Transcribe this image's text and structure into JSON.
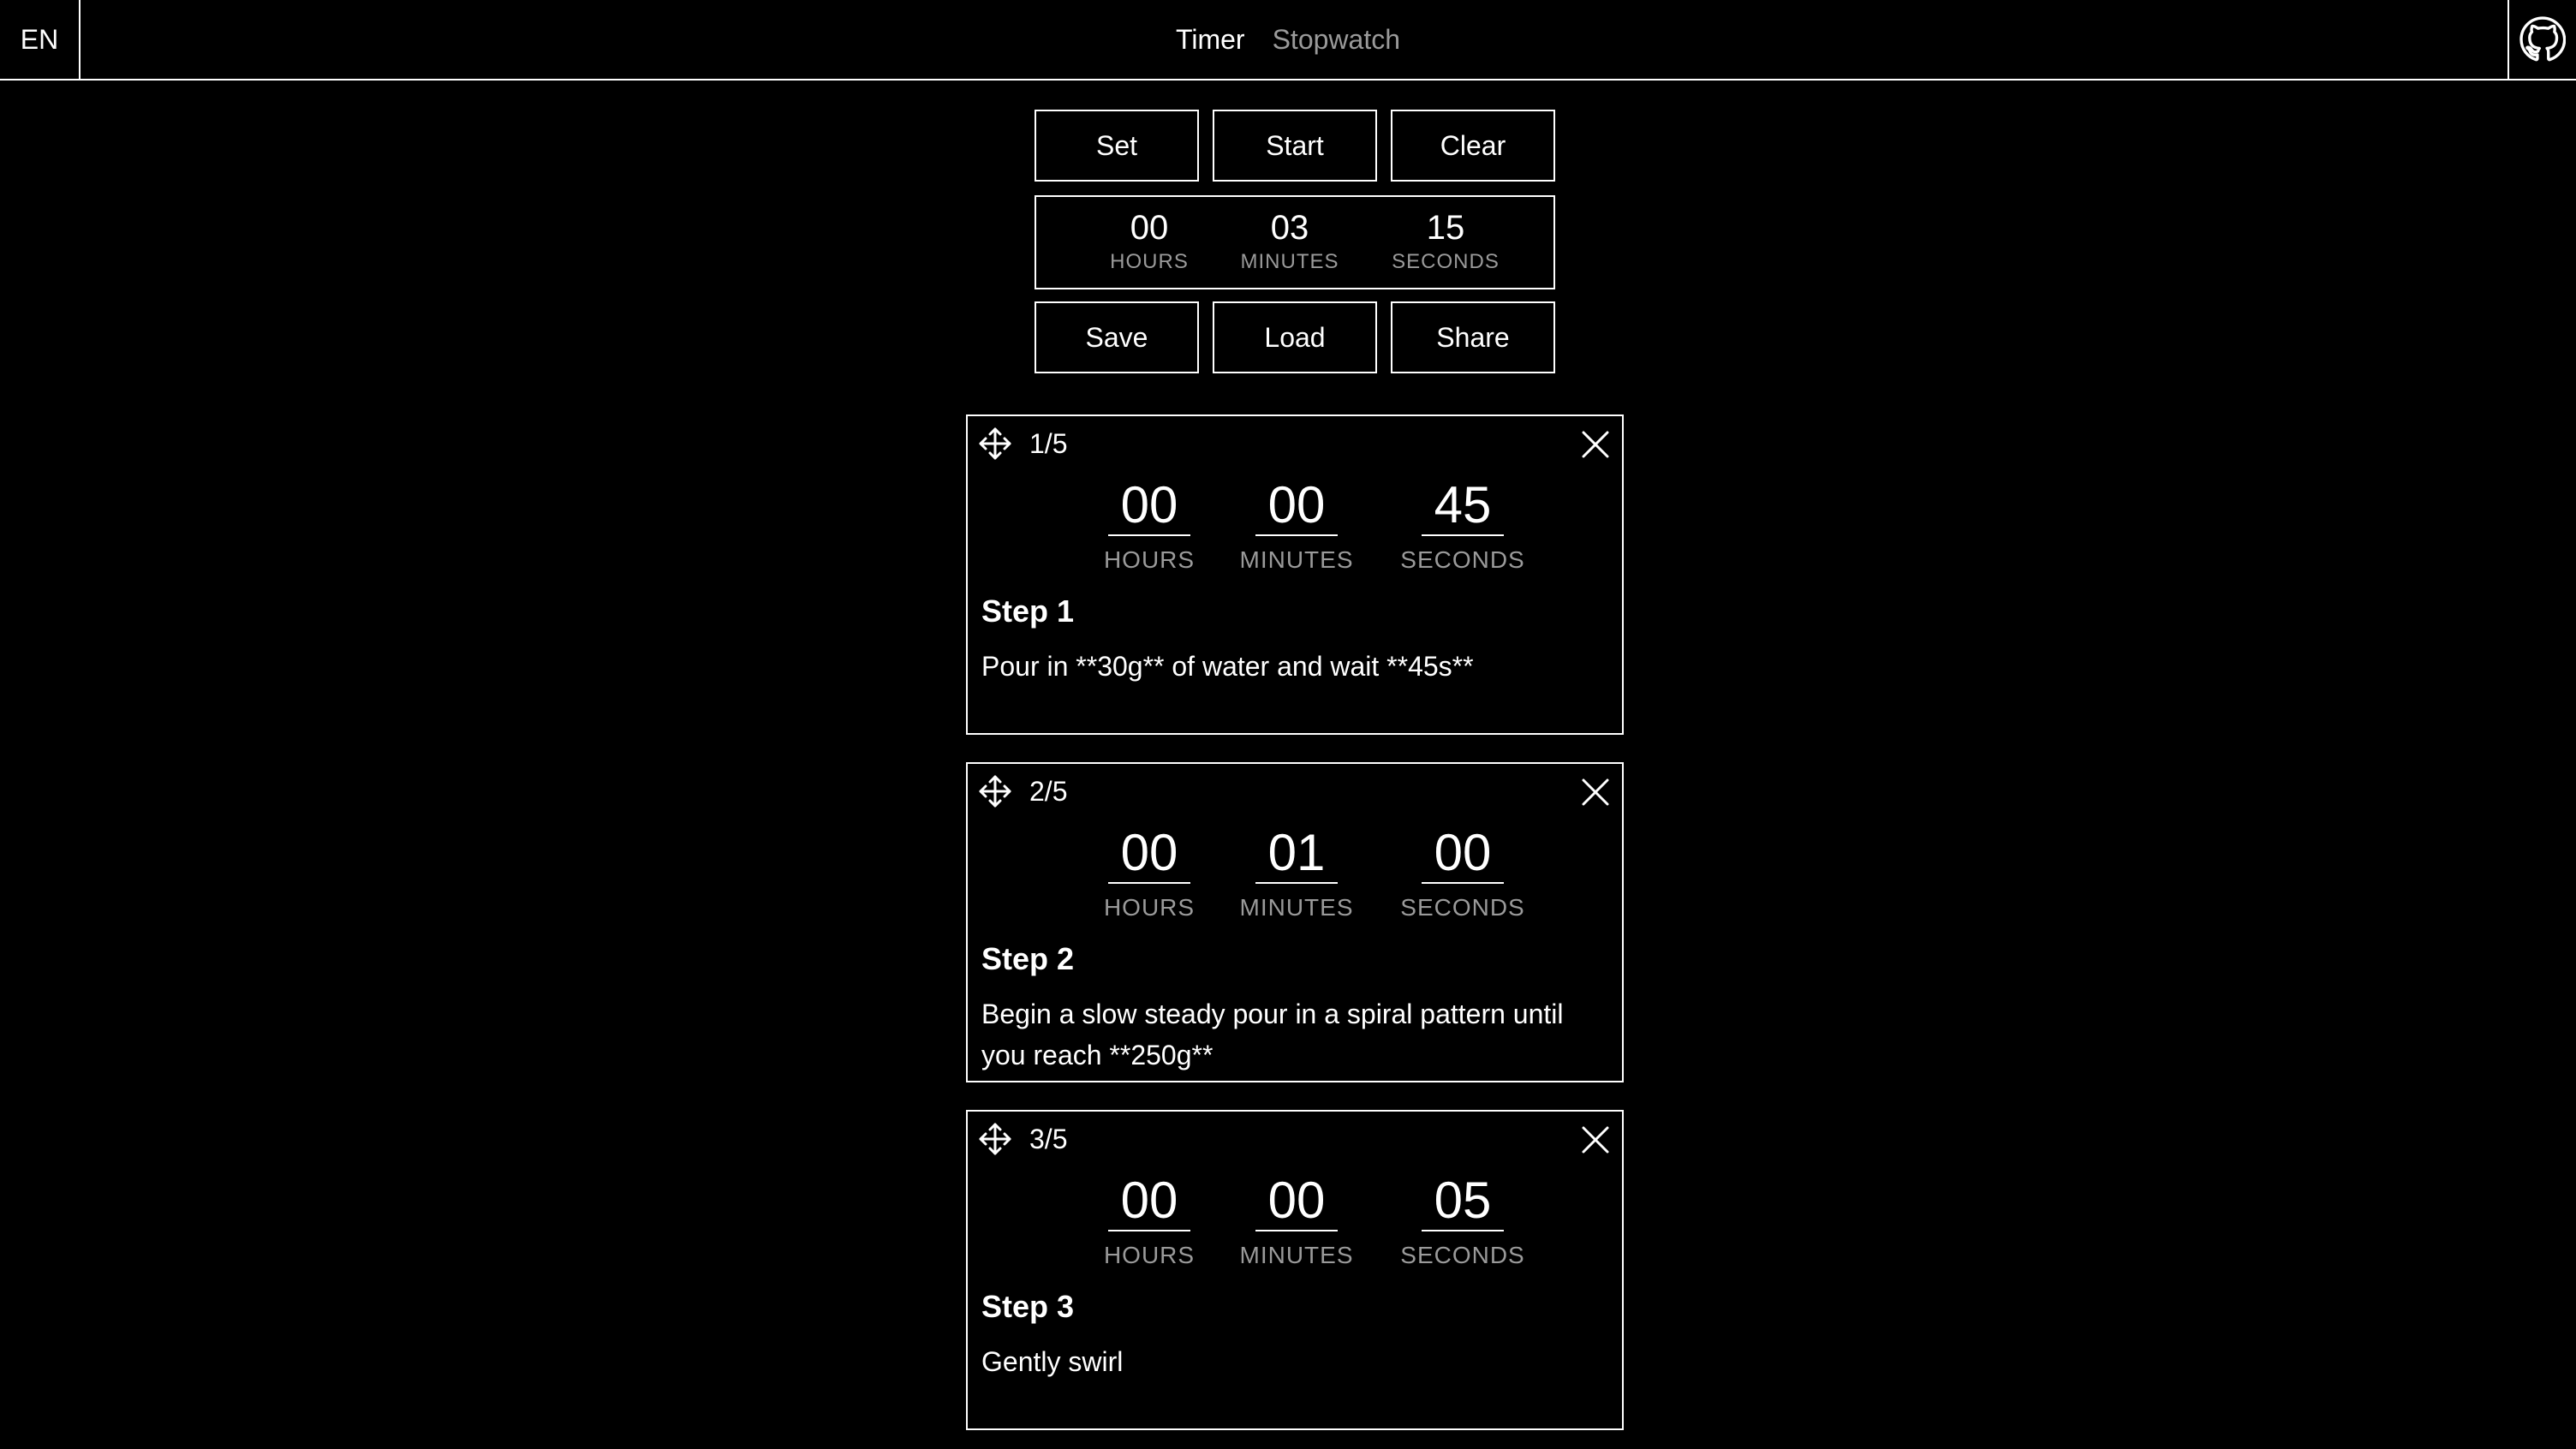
{
  "header": {
    "language": "EN",
    "tabs": [
      {
        "label": "Timer",
        "active": true
      },
      {
        "label": "Stopwatch",
        "active": false
      }
    ],
    "github_icon": "github-icon"
  },
  "controls": {
    "set_label": "Set",
    "start_label": "Start",
    "clear_label": "Clear",
    "save_label": "Save",
    "load_label": "Load",
    "share_label": "Share"
  },
  "total_time": {
    "hours": "00",
    "minutes": "03",
    "seconds": "15",
    "hours_label": "HOURS",
    "minutes_label": "MINUTES",
    "seconds_label": "SECONDS"
  },
  "units": {
    "hours": "HOURS",
    "minutes": "MINUTES",
    "seconds": "SECONDS"
  },
  "steps": [
    {
      "position": "1/5",
      "hours": "00",
      "minutes": "00",
      "seconds": "45",
      "title": "Step 1",
      "description": "Pour in **30g** of water and wait **45s**"
    },
    {
      "position": "2/5",
      "hours": "00",
      "minutes": "01",
      "seconds": "00",
      "title": "Step 2",
      "description": "Begin a slow steady pour in a spiral pattern until you reach **250g**"
    },
    {
      "position": "3/5",
      "hours": "00",
      "minutes": "00",
      "seconds": "05",
      "title": "Step 3",
      "description": "Gently swirl"
    }
  ],
  "colors": {
    "background": "#000000",
    "foreground": "#ffffff",
    "muted": "#9a9a9a"
  }
}
